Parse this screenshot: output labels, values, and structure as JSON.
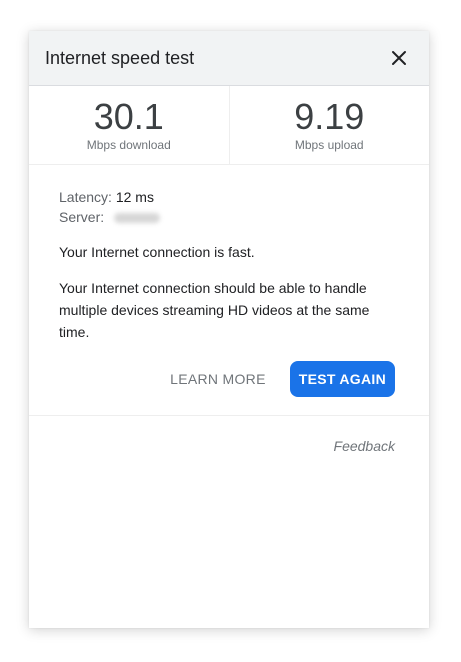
{
  "dialog": {
    "title": "Internet speed test",
    "close_icon": "close-icon"
  },
  "metrics": {
    "download": {
      "value": "30.1",
      "label": "Mbps download"
    },
    "upload": {
      "value": "9.19",
      "label": "Mbps upload"
    }
  },
  "details": {
    "latency_label": "Latency:",
    "latency_value": "12 ms",
    "server_label": "Server:"
  },
  "messages": {
    "summary": "Your Internet connection is fast.",
    "description": "Your Internet connection should be able to handle multiple devices streaming HD videos at the same time."
  },
  "actions": {
    "learn_more": "LEARN MORE",
    "test_again": "TEST AGAIN"
  },
  "footer": {
    "feedback": "Feedback"
  },
  "colors": {
    "accent": "#1a73e8",
    "header_bg": "#f1f3f4"
  }
}
